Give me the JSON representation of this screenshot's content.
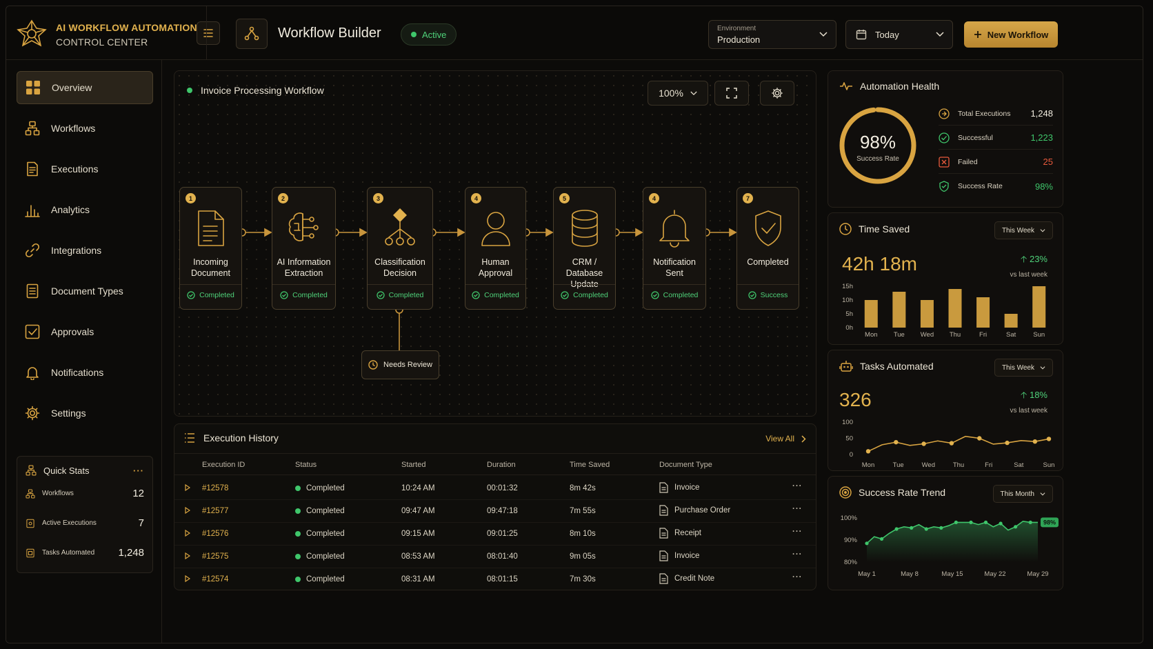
{
  "header": {
    "brand_title": "AI WORKFLOW AUTOMATION",
    "brand_subtitle": "CONTROL CENTER",
    "page_title": "Workflow Builder",
    "status": "Active",
    "environment_label": "Environment",
    "environment_value": "Production",
    "date_range": "Today",
    "new_workflow": "New Workflow"
  },
  "sidebar": {
    "items": [
      {
        "label": "Overview",
        "icon": "grid-icon",
        "selected": true
      },
      {
        "label": "Workflows",
        "icon": "workflow-icon"
      },
      {
        "label": "Executions",
        "icon": "document-list-icon"
      },
      {
        "label": "Analytics",
        "icon": "bar-chart-icon"
      },
      {
        "label": "Integrations",
        "icon": "link-icon"
      },
      {
        "label": "Document Types",
        "icon": "document-icon"
      },
      {
        "label": "Approvals",
        "icon": "checkbox-icon"
      },
      {
        "label": "Notifications",
        "icon": "bell-icon"
      },
      {
        "label": "Settings",
        "icon": "gear-icon"
      }
    ],
    "quick_stats": {
      "title": "Quick Stats",
      "rows": [
        {
          "label": "Workflows",
          "value": "12"
        },
        {
          "label": "Active Executions",
          "value": "7"
        },
        {
          "label": "Tasks Automated",
          "value": "1,248"
        }
      ]
    }
  },
  "canvas": {
    "title": "Invoice Processing Workflow",
    "zoom": "100%",
    "nodes": [
      {
        "num": "1",
        "line1": "Incoming",
        "line2": "Document",
        "status": "Completed",
        "icon": "document-icon"
      },
      {
        "num": "2",
        "line1": "AI Information",
        "line2": "Extraction",
        "status": "Completed",
        "icon": "ai-brain-icon"
      },
      {
        "num": "3",
        "line1": "Classification",
        "line2": "Decision",
        "status": "Completed",
        "icon": "decision-tree-icon"
      },
      {
        "num": "4",
        "line1": "Human",
        "line2": "Approval",
        "status": "Completed",
        "icon": "user-icon"
      },
      {
        "num": "5",
        "line1": "CRM / Database",
        "line2": "Update",
        "status": "Completed",
        "icon": "database-icon"
      },
      {
        "num": "4",
        "line1": "Notification",
        "line2": "Sent",
        "status": "Completed",
        "icon": "bell-icon"
      },
      {
        "num": "7",
        "line1": "Completed",
        "line2": "",
        "status": "Success",
        "icon": "shield-check-icon"
      }
    ],
    "review_label": "Needs Review"
  },
  "history": {
    "title": "Execution History",
    "view_all": "View All",
    "columns": [
      "Execution ID",
      "Status",
      "Started",
      "Duration",
      "Time Saved",
      "Document Type"
    ],
    "rows": [
      {
        "id": "#12578",
        "status": "Completed",
        "started": "10:24 AM",
        "duration": "00:01:32",
        "saved": "8m 42s",
        "doc": "Invoice"
      },
      {
        "id": "#12577",
        "status": "Completed",
        "started": "09:47 AM",
        "duration": "09:47:18",
        "saved": "7m 55s",
        "doc": "Purchase Order"
      },
      {
        "id": "#12576",
        "status": "Completed",
        "started": "09:15 AM",
        "duration": "09:01:25",
        "saved": "8m 10s",
        "doc": "Receipt"
      },
      {
        "id": "#12575",
        "status": "Completed",
        "started": "08:53 AM",
        "duration": "08:01:40",
        "saved": "9m 05s",
        "doc": "Invoice"
      },
      {
        "id": "#12574",
        "status": "Completed",
        "started": "08:31 AM",
        "duration": "08:01:15",
        "saved": "7m 30s",
        "doc": "Credit Note"
      }
    ]
  },
  "health": {
    "title": "Automation Health",
    "rate": "98%",
    "rate_fraction": 0.98,
    "rate_label": "Success Rate",
    "rows": [
      {
        "label": "Total Executions",
        "value": "1,248",
        "tone": "plain",
        "icon": "flow-icon"
      },
      {
        "label": "Successful",
        "value": "1,223",
        "tone": "green",
        "icon": "check-circle-icon"
      },
      {
        "label": "Failed",
        "value": "25",
        "tone": "red",
        "icon": "x-box-icon"
      },
      {
        "label": "Success Rate",
        "value": "98%",
        "tone": "green",
        "icon": "shield-icon"
      }
    ]
  },
  "time_saved": {
    "title": "Time Saved",
    "period": "This Week",
    "value": "42h 18m",
    "delta": "23%",
    "delta_note": "vs last week"
  },
  "tasks": {
    "title": "Tasks Automated",
    "period": "This Week",
    "value": "326",
    "delta": "18%",
    "delta_note": "vs last week"
  },
  "trend": {
    "title": "Success Rate Trend",
    "period": "This Month",
    "end_label": "98%"
  },
  "chart_data": [
    {
      "type": "bar",
      "title": "Time Saved",
      "categories": [
        "Mon",
        "Tue",
        "Wed",
        "Thu",
        "Fri",
        "Sat",
        "Sun"
      ],
      "values": [
        10,
        13,
        10,
        14,
        11,
        5,
        15
      ],
      "yticks": [
        "0h",
        "5h",
        "10h",
        "15h"
      ],
      "ylim": [
        0,
        15
      ]
    },
    {
      "type": "line",
      "title": "Tasks Automated",
      "categories": [
        "Mon",
        "Tue",
        "Wed",
        "Thu",
        "Fri",
        "Sat",
        "Sun"
      ],
      "values": [
        10,
        30,
        38,
        28,
        33,
        42,
        35,
        56,
        50,
        32,
        36,
        43,
        40,
        48
      ],
      "yticks": [
        "0",
        "50",
        "100"
      ],
      "ylim": [
        0,
        100
      ]
    },
    {
      "type": "area",
      "title": "Success Rate Trend",
      "x": [
        "May 1",
        "May 8",
        "May 15",
        "May 22",
        "May 29"
      ],
      "values": [
        88.5,
        91.5,
        90.5,
        93,
        95,
        96,
        95.5,
        97,
        95,
        96,
        95.5,
        96.5,
        98,
        98,
        98,
        97,
        98,
        96,
        97.5,
        94.5,
        96,
        98.5,
        98,
        98
      ],
      "yticks": [
        "80%",
        "90%",
        "100%"
      ],
      "ylim": [
        80,
        100
      ]
    }
  ],
  "colors": {
    "accent": "#e2b24e",
    "success": "#3fc66b",
    "danger": "#e85a3c",
    "background": "#0c0b09"
  }
}
